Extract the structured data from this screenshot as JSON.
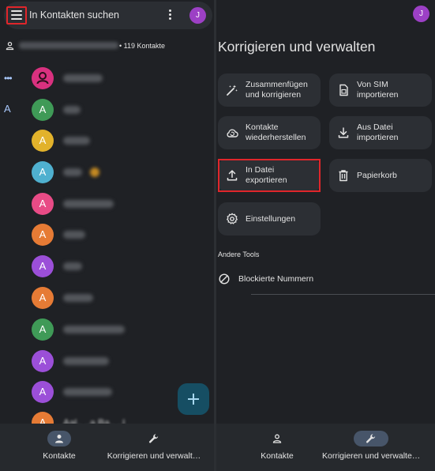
{
  "left_screen": {
    "search": {
      "placeholder": "In Kontakten suchen"
    },
    "user_avatar_letter": "J",
    "account": {
      "email_blurred": "",
      "contact_count": "• 119 Kontakte"
    },
    "alphabet_index": {
      "ellipsis": "•••",
      "letter": "A"
    },
    "contacts": [
      {
        "initial": "",
        "color": "#d9317f",
        "avatar_kind": "person-icon"
      },
      {
        "initial": "A",
        "color": "#3f9a57"
      },
      {
        "initial": "A",
        "color": "#e2b22b"
      },
      {
        "initial": "A",
        "color": "#4fb0cf"
      },
      {
        "initial": "A",
        "color": "#e84b86"
      },
      {
        "initial": "A",
        "color": "#e67b35"
      },
      {
        "initial": "A",
        "color": "#9b4fd8"
      },
      {
        "initial": "A",
        "color": "#e67b35"
      },
      {
        "initial": "A",
        "color": "#3f9a57"
      },
      {
        "initial": "A",
        "color": "#9b4fd8"
      },
      {
        "initial": "A",
        "color": "#9b4fd8"
      },
      {
        "initial": "A",
        "color": "#e67b35",
        "name": "Aal.. ..a Ba.. ..l"
      }
    ],
    "fab_icon": "plus-icon",
    "nav": [
      {
        "label": "Kontakte",
        "icon": "person-icon",
        "selected": true
      },
      {
        "label": "Korrigieren und verwalt…",
        "icon": "wrench-icon",
        "selected": false
      }
    ]
  },
  "right_screen": {
    "user_avatar_letter": "J",
    "title": "Korrigieren und verwalten",
    "tiles": [
      {
        "label_line1": "Zusammenfügen",
        "label_line2": "und korrigieren",
        "icon": "magic-wand-icon"
      },
      {
        "label_line1": "Von SIM",
        "label_line2": "importieren",
        "icon": "sim-card-icon"
      },
      {
        "label_line1": "Kontakte",
        "label_line2": "wiederherstellen",
        "icon": "cloud-restore-icon"
      },
      {
        "label_line1": "Aus Datei",
        "label_line2": "importieren",
        "icon": "download-icon"
      },
      {
        "label_line1": "In Datei",
        "label_line2": "exportieren",
        "icon": "upload-icon",
        "highlighted": true
      },
      {
        "label_line1": "Papierkorb",
        "label_line2": "",
        "icon": "trash-icon"
      },
      {
        "label_line1": "Einstellungen",
        "label_line2": "",
        "icon": "gear-icon"
      }
    ],
    "section_header": "Andere Tools",
    "blocked_numbers": {
      "label": "Blockierte Nummern",
      "icon": "block-icon"
    },
    "nav": [
      {
        "label": "Kontakte",
        "icon": "person-icon",
        "selected": false
      },
      {
        "label": "Korrigieren und verwalte…",
        "icon": "wrench-icon",
        "selected": true
      }
    ]
  },
  "colors": {
    "background": "#1f2125",
    "surface": "#2c2f34",
    "highlight_box": "#e0262b",
    "avatar_j": "#9c40c5",
    "nav_pill": "#475569",
    "fab": "#164e63"
  }
}
